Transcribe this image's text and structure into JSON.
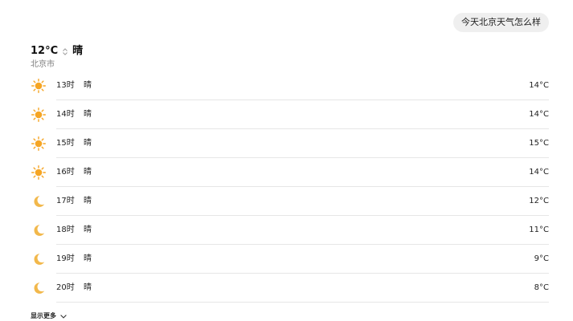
{
  "query": {
    "text": "今天北京天气怎么样"
  },
  "summary": {
    "temperature": "12°C",
    "condition": "晴",
    "city": "北京市",
    "sort_icon": "up-down-arrows-icon"
  },
  "forecast": [
    {
      "hour": "13时",
      "condition": "晴",
      "temp": "14°C",
      "icon": "sun-icon"
    },
    {
      "hour": "14时",
      "condition": "晴",
      "temp": "14°C",
      "icon": "sun-icon"
    },
    {
      "hour": "15时",
      "condition": "晴",
      "temp": "15°C",
      "icon": "sun-icon"
    },
    {
      "hour": "16时",
      "condition": "晴",
      "temp": "14°C",
      "icon": "sun-icon"
    },
    {
      "hour": "17时",
      "condition": "晴",
      "temp": "12°C",
      "icon": "moon-icon"
    },
    {
      "hour": "18时",
      "condition": "晴",
      "temp": "11°C",
      "icon": "moon-icon"
    },
    {
      "hour": "19时",
      "condition": "晴",
      "temp": "9°C",
      "icon": "moon-icon"
    },
    {
      "hour": "20时",
      "condition": "晴",
      "temp": "8°C",
      "icon": "moon-icon"
    }
  ],
  "show_more": {
    "label": "显示更多",
    "icon": "chevron-down-icon"
  },
  "colors": {
    "sun": "#f5a524",
    "moon": "#f2b84b",
    "divider": "#e6e6e6",
    "bubble": "#efefef"
  }
}
